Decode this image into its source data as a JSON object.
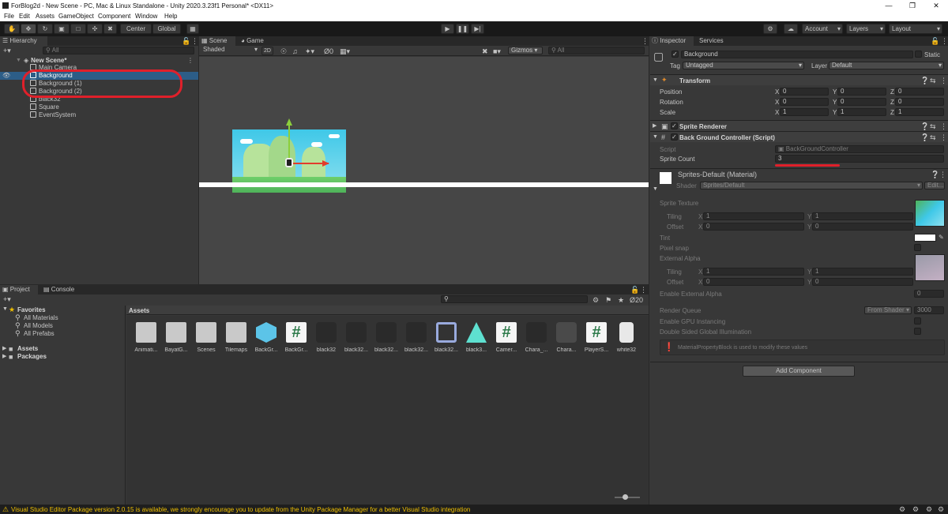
{
  "window": {
    "title": "ForBlog2d - New Scene - PC, Mac & Linux Standalone - Unity 2020.3.23f1 Personal* <DX11>"
  },
  "menu": [
    "File",
    "Edit",
    "Assets",
    "GameObject",
    "Component",
    "Window",
    "Help"
  ],
  "toolbar": {
    "center": "Center",
    "global": "Global",
    "account": "Account",
    "layers": "Layers",
    "layout": "Layout"
  },
  "hierarchy": {
    "tab": "Hierarchy",
    "search_placeholder": "All",
    "scene": "New Scene*",
    "items": [
      "Main Camera",
      "Background",
      "Background (1)",
      "Background (2)",
      "black32",
      "Square",
      "EventSystem"
    ]
  },
  "scene_view": {
    "tabs": [
      "Scene",
      "Game"
    ],
    "shading": "Shaded",
    "mode2d": "2D",
    "fx_count": "0",
    "gizmos": "Gizmos",
    "search_placeholder": "All"
  },
  "project": {
    "tabs": [
      "Project",
      "Console"
    ],
    "favorites": "Favorites",
    "fav_items": [
      "All Materials",
      "All Models",
      "All Prefabs"
    ],
    "roots": [
      "Assets",
      "Packages"
    ],
    "breadcrumb": "Assets",
    "hidden_count": "20",
    "assets": [
      "Animati...",
      "BayatG...",
      "Scenes",
      "Tilemaps",
      "BackGr...",
      "BackGr...",
      "black32",
      "black32...",
      "black32...",
      "black32...",
      "black32...",
      "black3...",
      "Camer...",
      "Chara_...",
      "Chara...",
      "PlayerS...",
      "white32"
    ]
  },
  "inspector": {
    "tabs": [
      "Inspector",
      "Services"
    ],
    "object_name": "Background",
    "static": "Static",
    "tag_label": "Tag",
    "tag_value": "Untagged",
    "layer_label": "Layer",
    "layer_value": "Default",
    "transform": {
      "title": "Transform",
      "position_label": "Position",
      "position": [
        "0",
        "0",
        "0"
      ],
      "rotation_label": "Rotation",
      "rotation": [
        "0",
        "0",
        "0"
      ],
      "scale_label": "Scale",
      "scale": [
        "1",
        "1",
        "1"
      ]
    },
    "sprite_renderer": "Sprite Renderer",
    "bg_controller": {
      "title": "Back Ground Controller (Script)",
      "script_label": "Script",
      "script_value": "BackGroundController",
      "sprite_count_label": "Sprite Count",
      "sprite_count": "3"
    },
    "material": {
      "title": "Sprites-Default (Material)",
      "shader_label": "Shader",
      "shader_value": "Sprites/Default",
      "edit": "Edit...",
      "sprite_texture": "Sprite Texture",
      "tiling": "Tiling",
      "offset": "Offset",
      "tiling_x": "1",
      "tiling_y": "1",
      "offset_x": "0",
      "offset_y": "0",
      "tint": "Tint",
      "pixel_snap": "Pixel snap",
      "external_alpha": "External Alpha",
      "tiling2_x": "1",
      "tiling2_y": "1",
      "offset2_x": "0",
      "offset2_y": "0",
      "enable_external_alpha": "Enable External Alpha",
      "enable_external_alpha_value": "0",
      "render_queue": "Render Queue",
      "render_queue_mode": "From Shader",
      "render_queue_value": "3000",
      "gpu_instancing": "Enable GPU Instancing",
      "double_sided_gi": "Double Sided Global Illumination",
      "info": "MaterialPropertyBlock is used to modify these values"
    },
    "add_component": "Add Component"
  },
  "status": {
    "message": "Visual Studio Editor Package version 2.0.15 is available, we strongly encourage you to update from the Unity Package Manager for a better Visual Studio integration"
  },
  "colors": {
    "accent_selection": "#2c5d87",
    "annotation_red": "#e0202a",
    "warning": "#f0c000"
  }
}
